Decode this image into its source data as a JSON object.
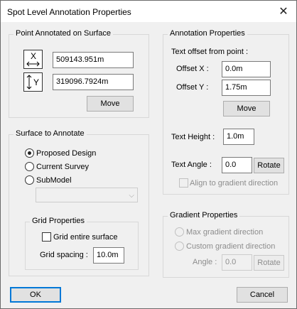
{
  "window": {
    "title": "Spot Level Annotation Properties",
    "close_glyph": "✕"
  },
  "point_group": {
    "label": "Point Annotated on Surface",
    "x_icon": "X",
    "y_icon": "Y",
    "x_value": "509143.951m",
    "y_value": "319096.7924m",
    "move_label": "Move"
  },
  "surface_group": {
    "label": "Surface to Annotate",
    "options": [
      "Proposed Design",
      "Current Survey",
      "SubModel"
    ],
    "selected": "Proposed Design",
    "submodel_value": ""
  },
  "grid_group": {
    "label": "Grid Properties",
    "entire_surface_label": "Grid entire surface",
    "spacing_label": "Grid spacing :",
    "spacing_value": "10.0m"
  },
  "annotation_group": {
    "label": "Annotation Properties",
    "offset_heading": "Text offset from point :",
    "offset_x_label": "Offset X :",
    "offset_x_value": "0.0m",
    "offset_y_label": "Offset Y :",
    "offset_y_value": "1.75m",
    "move_label": "Move",
    "height_label": "Text Height :",
    "height_value": "1.0m",
    "angle_label": "Text Angle :",
    "angle_value": "0.0",
    "rotate_label": "Rotate",
    "align_label": "Align to gradient direction"
  },
  "gradient_group": {
    "label": "Gradient Properties",
    "max_label": "Max gradient direction",
    "custom_label": "Custom gradient direction",
    "angle_label": "Angle :",
    "angle_value": "0.0",
    "rotate_label": "Rotate"
  },
  "footer": {
    "ok_label": "OK",
    "cancel_label": "Cancel"
  },
  "colors": {
    "accent": "#0078d7",
    "background": "#f0f0f0",
    "disabled_text": "#8d8d8d"
  }
}
